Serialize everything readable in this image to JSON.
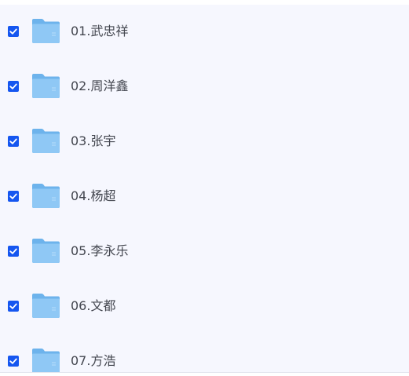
{
  "file_list": {
    "items": [
      {
        "name": "01.武忠祥",
        "checked": true,
        "icon": "folder-icon"
      },
      {
        "name": "02.周洋鑫",
        "checked": true,
        "icon": "folder-icon"
      },
      {
        "name": "03.张宇",
        "checked": true,
        "icon": "folder-icon"
      },
      {
        "name": "04.杨超",
        "checked": true,
        "icon": "folder-icon"
      },
      {
        "name": "05.李永乐",
        "checked": true,
        "icon": "folder-icon"
      },
      {
        "name": "06.文都",
        "checked": true,
        "icon": "folder-icon"
      },
      {
        "name": "07.方浩",
        "checked": true,
        "icon": "folder-icon"
      }
    ]
  },
  "colors": {
    "background": "#f6f7fe",
    "checkbox": "#1556f0",
    "folder_front": "#8fc8f5",
    "folder_back": "#6db3ec",
    "text": "#43464f"
  }
}
